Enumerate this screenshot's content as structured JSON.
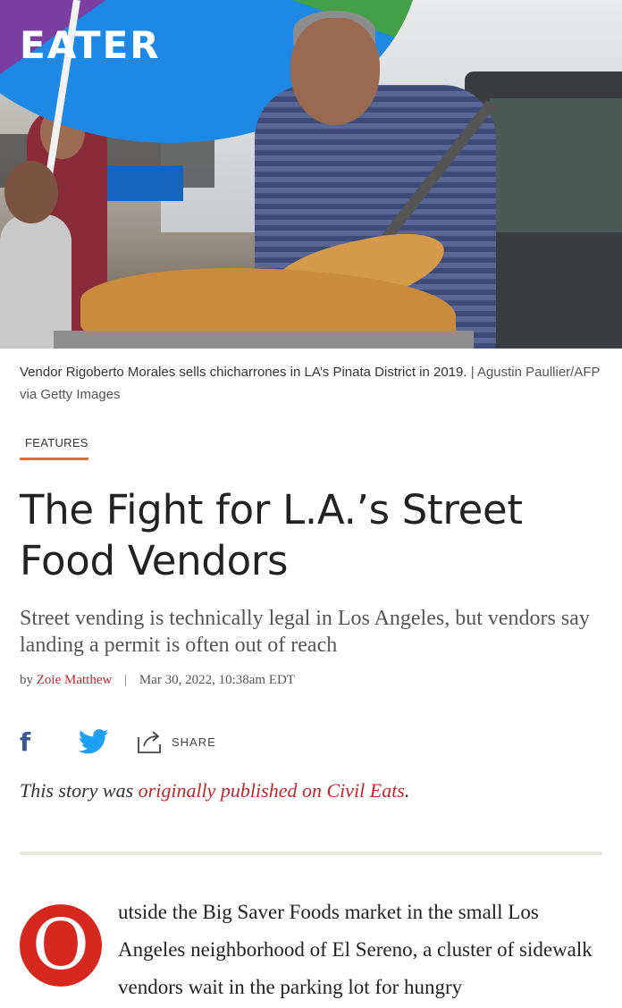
{
  "brand": {
    "logo_text": "EATER"
  },
  "hero": {
    "caption": "Vendor Rigoberto Morales sells chicharrones in LA’s Pinata District in 2019.",
    "credit_sep": "|",
    "credit": "Agustin Paullier/AFP via Getty Images"
  },
  "article": {
    "kicker": "FEATURES",
    "headline": "The Fight for L.A.’s Street Food Vendors",
    "dek": "Street vending is technically legal in Los Angeles, but vendors say landing a permit is often out of reach",
    "byline_prefix": "by",
    "author": "Zoie Matthew",
    "byline_sep": "|",
    "date": "Mar 30, 2022, 10:38am EDT",
    "note_prefix": "This story was",
    "note_link": "originally published on Civil Eats",
    "note_suffix": ".",
    "drop_cap": "O",
    "body_text": "utside the Big Saver Foods market in the small Los Angeles neighborhood of El Sereno, a cluster of sidewalk vendors wait in the parking lot for hungry"
  },
  "share": {
    "facebook_glyph": "f",
    "label": "SHARE"
  },
  "colors": {
    "accent_red": "#c1272d",
    "kicker_rule": "#e36c2a",
    "facebook": "#3b5998",
    "twitter": "#1da1f2",
    "dropcap": "#d6281f"
  },
  "icons": [
    "facebook-icon",
    "twitter-icon",
    "share-icon"
  ]
}
